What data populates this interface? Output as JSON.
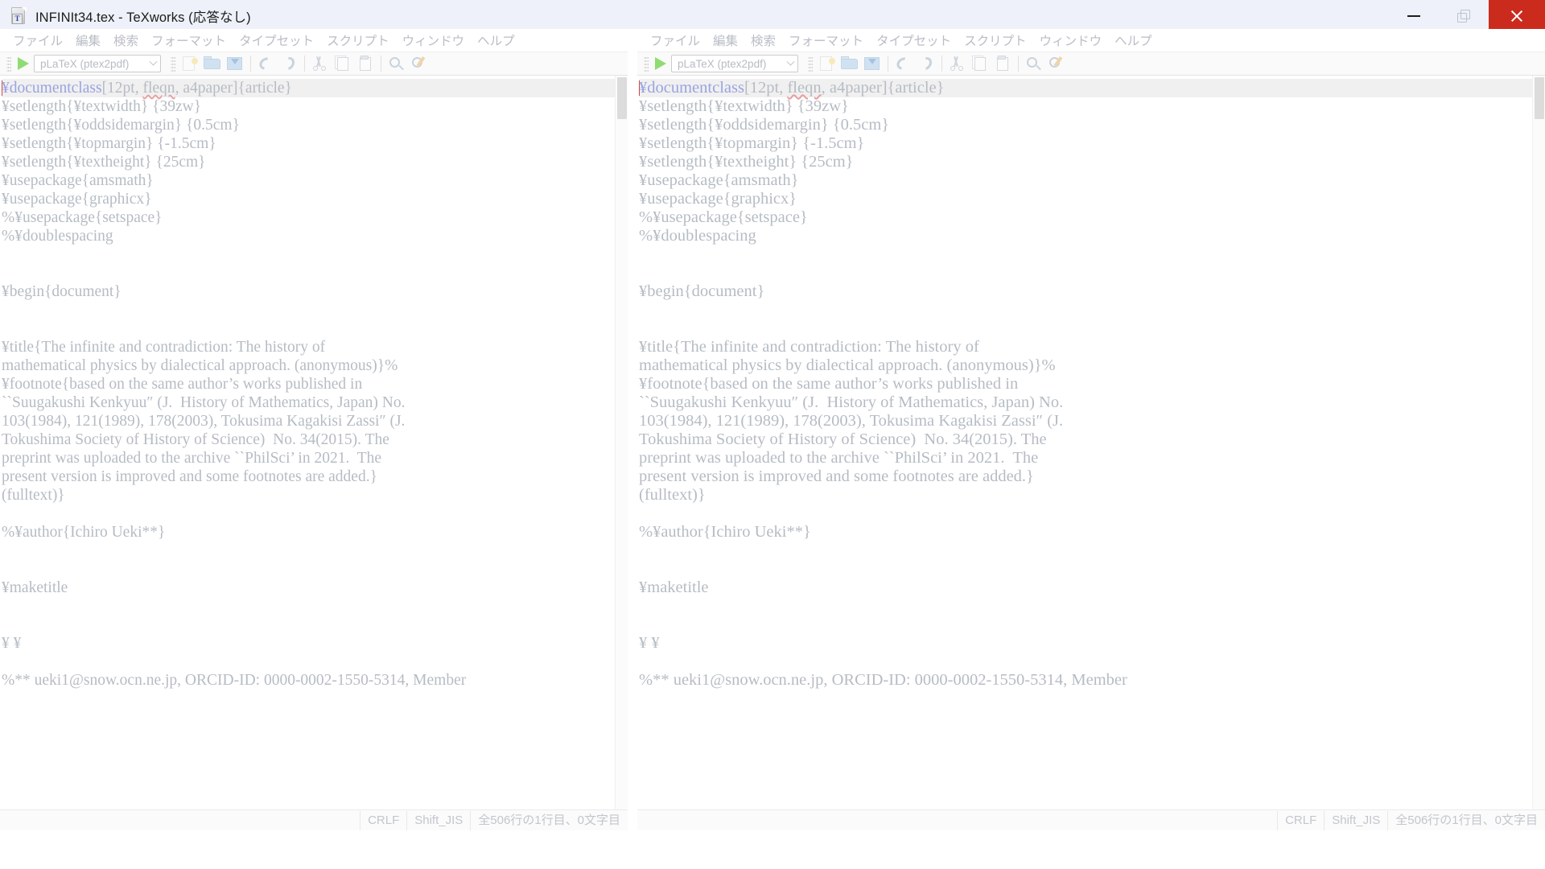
{
  "window": {
    "title": "INFINIt34.tex - TeXworks (応答なし)",
    "app_icon_letter": "T",
    "controls": {
      "minimize": "minimize-button",
      "restore": "restore-button",
      "close": "close-button"
    },
    "colors": {
      "titlebar_bg": "#eef1f9",
      "close_bg": "#cb2b1d",
      "disabled_text": "#b9bdc6",
      "keyword": "#9aa3e0",
      "highlight_line": "#f0f0f0",
      "play_green": "#8fdc74"
    }
  },
  "menu": {
    "items": [
      {
        "label": "ファイル",
        "name": "menu-file"
      },
      {
        "label": "編集",
        "name": "menu-edit"
      },
      {
        "label": "検索",
        "name": "menu-search"
      },
      {
        "label": "フォーマット",
        "name": "menu-format"
      },
      {
        "label": "タイプセット",
        "name": "menu-typeset"
      },
      {
        "label": "スクリプト",
        "name": "menu-scripts"
      },
      {
        "label": "ウィンドウ",
        "name": "menu-window"
      },
      {
        "label": "ヘルプ",
        "name": "menu-help"
      }
    ]
  },
  "toolbar": {
    "typeset_engine": "pLaTeX (ptex2pdf)",
    "run_button": "typeset-run-button",
    "icons": [
      "new-document-icon",
      "open-folder-icon",
      "save-icon",
      "undo-icon",
      "redo-icon",
      "cut-icon",
      "copy-icon",
      "paste-icon",
      "find-icon",
      "search-replace-icon"
    ]
  },
  "editor": {
    "lines": [
      {
        "text": "¥documentclass[12pt, fleqn, a4paper]{article}",
        "highlight": true,
        "kw_end": 14,
        "squiggle": "fleqn"
      },
      {
        "text": "¥setlength{¥textwidth} {39zw}"
      },
      {
        "text": "¥setlength{¥oddsidemargin} {0.5cm}"
      },
      {
        "text": "¥setlength{¥topmargin} {-1.5cm}"
      },
      {
        "text": "¥setlength{¥textheight} {25cm}"
      },
      {
        "text": "¥usepackage{amsmath}"
      },
      {
        "text": "¥usepackage{graphicx}"
      },
      {
        "text": "%¥usepackage{setspace}"
      },
      {
        "text": "%¥doublespacing"
      },
      {
        "text": ""
      },
      {
        "text": ""
      },
      {
        "text": "¥begin{document}"
      },
      {
        "text": ""
      },
      {
        "text": ""
      },
      {
        "text": "¥title{The infinite and contradiction: The history of"
      },
      {
        "text": "mathematical physics by dialectical approach. (anonymous)}%"
      },
      {
        "text": "¥footnote{based on the same author’s works published in"
      },
      {
        "text": "``Suugakushi Kenkyuu″ (J.  History of Mathematics, Japan) No."
      },
      {
        "text": "103(1984), 121(1989), 178(2003), Tokusima Kagakisi Zassi″ (J."
      },
      {
        "text": "Tokushima Society of History of Science)  No. 34(2015). The"
      },
      {
        "text": "preprint was uploaded to the archive ``PhilSci’ in 2021.  The"
      },
      {
        "text": "present version is improved and some footnotes are added.}"
      },
      {
        "text": "(fulltext)}"
      },
      {
        "text": ""
      },
      {
        "text": "%¥author{Ichiro Ueki**}"
      },
      {
        "text": ""
      },
      {
        "text": ""
      },
      {
        "text": "¥maketitle"
      },
      {
        "text": ""
      },
      {
        "text": ""
      },
      {
        "text": "¥ ¥"
      },
      {
        "text": ""
      },
      {
        "text": "%** ueki1@snow.ocn.ne.jp, ORCID-ID: 0000-0002-1550-5314, Member"
      }
    ]
  },
  "statusbar": {
    "line_ending": "CRLF",
    "encoding": "Shift_JIS",
    "position": "全506行の1行目、0文字目"
  }
}
